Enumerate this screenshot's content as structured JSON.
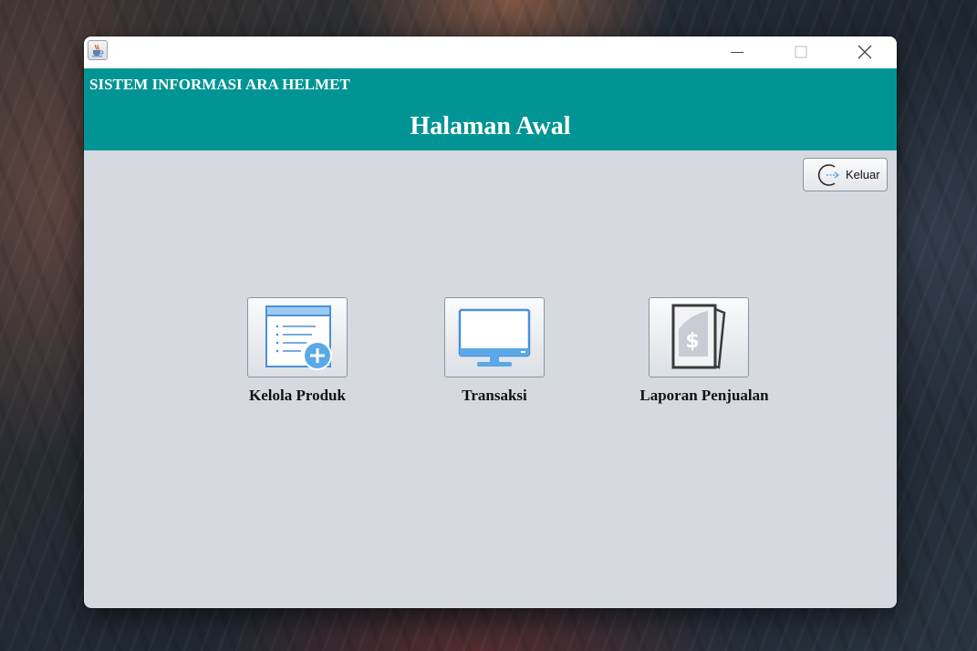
{
  "window": {
    "app_title": "SISTEM INFORMASI ARA HELMET",
    "page_title": "Halaman Awal"
  },
  "title_bar": {
    "app_icon": "java-coffee-cup-icon",
    "controls": [
      "minimize-icon",
      "maximize-icon",
      "close-icon"
    ]
  },
  "toolbar": {
    "logout_label": "Keluar",
    "logout_icon": "logout-arrow-icon"
  },
  "menu": {
    "items": [
      {
        "label": "Kelola Produk",
        "icon": "add-list-document-icon"
      },
      {
        "label": "Transaksi",
        "icon": "computer-monitor-icon"
      },
      {
        "label": "Laporan Penjualan",
        "icon": "dollar-report-icon"
      }
    ]
  },
  "colors": {
    "header": "#009494",
    "window_body": "#d6d9e0",
    "icon_accent": "#5aa8e8"
  }
}
